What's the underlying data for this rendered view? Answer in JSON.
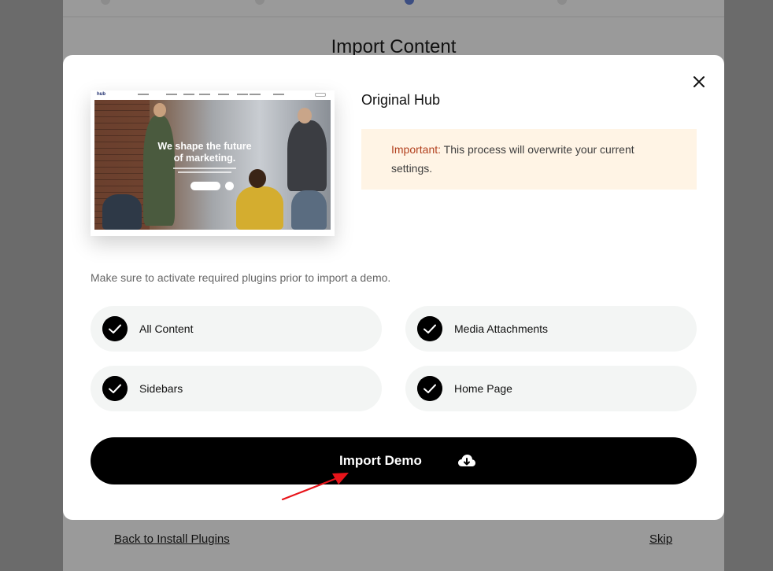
{
  "background": {
    "title": "Import Content",
    "back_link": "Back to Install Plugins",
    "skip_link": "Skip"
  },
  "modal": {
    "demo_title": "Original Hub",
    "notice": {
      "strong": "Important:",
      "text": " This process will overwrite your current settings."
    },
    "preview": {
      "logo": "hub",
      "headline_line1": "We shape the future",
      "headline_line2": "of marketing."
    },
    "hint": "Make sure to activate required plugins prior to import a demo.",
    "options": [
      {
        "label": "All Content",
        "checked": true
      },
      {
        "label": "Media Attachments",
        "checked": true
      },
      {
        "label": "Sidebars",
        "checked": true
      },
      {
        "label": "Home Page",
        "checked": true
      }
    ],
    "import_button": {
      "label": "Import Demo",
      "icon": "cloud-download-icon"
    },
    "close_icon": "close-icon"
  },
  "colors": {
    "overlay": "#6b6b6b",
    "notice_bg": "#fff4e5",
    "notice_strong": "#b2401e",
    "option_bg": "#f3f5f4",
    "button_bg": "#000000",
    "annotation_arrow": "#e8141a"
  }
}
